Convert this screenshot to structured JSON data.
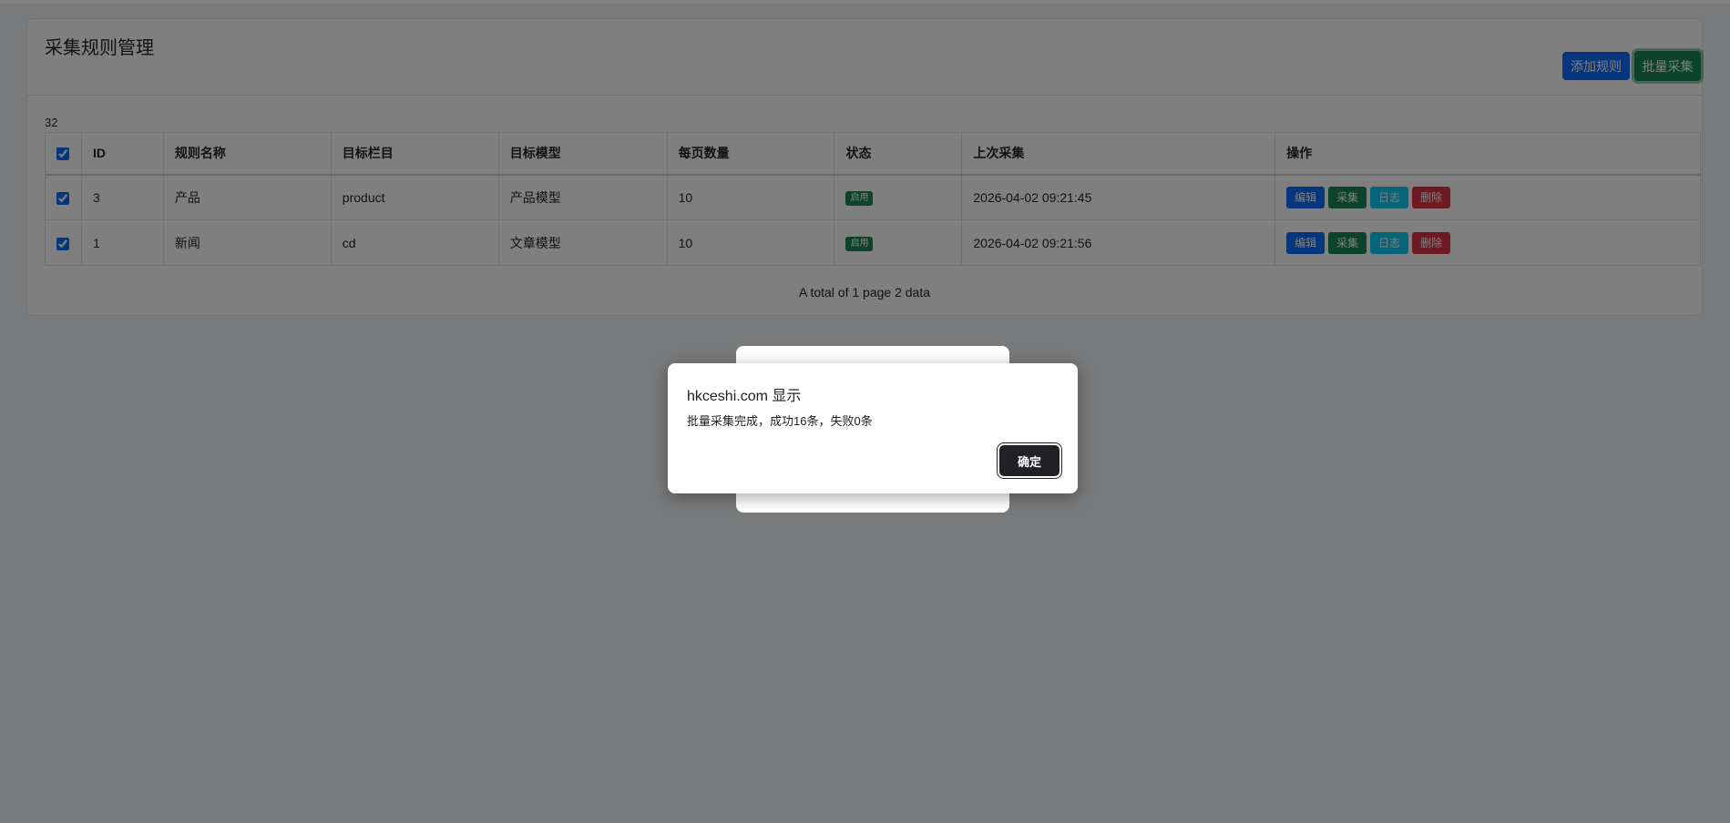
{
  "header": {
    "title": "采集规则管理",
    "add_label": "添加规则",
    "batch_label": "批量采集"
  },
  "count": "32",
  "table": {
    "columns": [
      "ID",
      "规则名称",
      "目标栏目",
      "目标模型",
      "每页数量",
      "状态",
      "上次采集",
      "操作"
    ],
    "rows": [
      {
        "checked": true,
        "id": "3",
        "name": "产品",
        "column": "product",
        "model": "产品模型",
        "per_page": "10",
        "status": "启用",
        "last": "2026-04-02 09:21:45"
      },
      {
        "checked": true,
        "id": "1",
        "name": "新闻",
        "column": "cd",
        "model": "文章模型",
        "per_page": "10",
        "status": "启用",
        "last": "2026-04-02 09:21:56"
      }
    ],
    "actions": {
      "edit": "编辑",
      "collect": "采集",
      "log": "日志",
      "delete": "删除"
    }
  },
  "pagination": "A total of 1 page 2 data",
  "dialog": {
    "title": "hkceshi.com 显示",
    "message": "批量采集完成，成功16条，失败0条",
    "ok_label": "确定"
  },
  "colors": {
    "primary": "#0d6efd",
    "success": "#198754",
    "info": "#0dcaf0",
    "danger": "#dc3545",
    "dialog_button": "#202124"
  }
}
